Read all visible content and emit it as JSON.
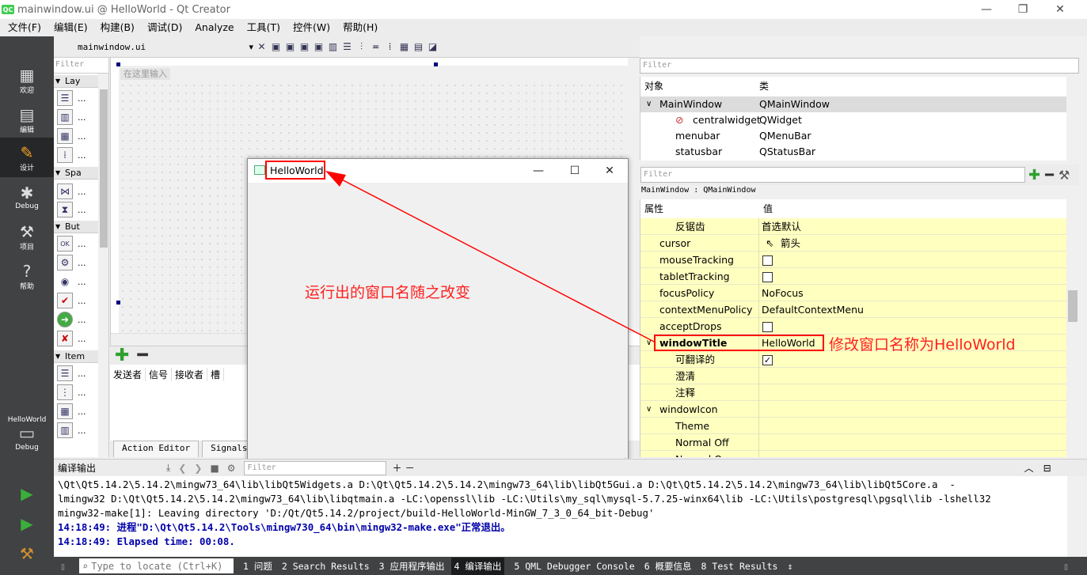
{
  "window": {
    "title": "mainwindow.ui @ HelloWorld - Qt Creator",
    "logo": "QC",
    "min": "—",
    "max": "❐",
    "close": "✕"
  },
  "menu": [
    "文件(F)",
    "编辑(E)",
    "构建(B)",
    "调试(D)",
    "Analyze",
    "工具(T)",
    "控件(W)",
    "帮助(H)"
  ],
  "modes": [
    {
      "label": "欢迎",
      "icon": "grid-icon"
    },
    {
      "label": "编辑",
      "icon": "document-icon"
    },
    {
      "label": "设计",
      "icon": "pencil-icon"
    },
    {
      "label": "Debug",
      "icon": "bug-icon"
    },
    {
      "label": "项目",
      "icon": "wrench-icon"
    },
    {
      "label": "帮助",
      "icon": "help-icon"
    }
  ],
  "project": {
    "name": "HelloWorld",
    "config": "Debug"
  },
  "widget_box": {
    "filter_placeholder": "Filter",
    "categories": [
      "Lay",
      "Spa",
      "But",
      "Item"
    ],
    "ellipsis": "..."
  },
  "design_toolbar": {
    "file": "mainwindow.ui"
  },
  "form": {
    "type_here": "在这里输入"
  },
  "signals": {
    "headers": [
      "发送者",
      "信号",
      "接收者",
      "槽"
    ],
    "tabs": [
      "Action Editor",
      "Signals _"
    ]
  },
  "object_inspector": {
    "filter_placeholder": "Filter",
    "col_object": "对象",
    "col_class": "类",
    "rows": [
      {
        "name": "MainWindow",
        "cls": "QMainWindow"
      },
      {
        "name": "centralwidget",
        "cls": "QWidget"
      },
      {
        "name": "menubar",
        "cls": "QMenuBar"
      },
      {
        "name": "statusbar",
        "cls": "QStatusBar"
      }
    ]
  },
  "property_editor": {
    "filter_placeholder": "Filter",
    "class_line": "MainWindow : QMainWindow",
    "col_prop": "属性",
    "col_value": "值",
    "rows": [
      {
        "name": "反锯齿",
        "value": "首选默认",
        "indent": 2
      },
      {
        "name": "cursor",
        "value": "箭头",
        "indent": 1,
        "icon": "arrow-cursor-icon"
      },
      {
        "name": "mouseTracking",
        "value": "",
        "indent": 1,
        "checkbox": false
      },
      {
        "name": "tabletTracking",
        "value": "",
        "indent": 1,
        "checkbox": false
      },
      {
        "name": "focusPolicy",
        "value": "NoFocus",
        "indent": 1
      },
      {
        "name": "contextMenuPolicy",
        "value": "DefaultContextMenu",
        "indent": 1
      },
      {
        "name": "acceptDrops",
        "value": "",
        "indent": 1,
        "checkbox": false
      },
      {
        "name": "windowTitle",
        "value": "HelloWorld",
        "indent": 1,
        "bold": true,
        "expand": "∨"
      },
      {
        "name": "可翻译的",
        "value": "",
        "indent": 2,
        "checkbox": true
      },
      {
        "name": "澄清",
        "value": "",
        "indent": 2
      },
      {
        "name": "注释",
        "value": "",
        "indent": 2
      },
      {
        "name": "windowIcon",
        "value": "",
        "indent": 1,
        "expand": "∨"
      },
      {
        "name": "Theme",
        "value": "",
        "indent": 2
      },
      {
        "name": "Normal Off",
        "value": "",
        "indent": 2
      },
      {
        "name": "Normal On",
        "value": "",
        "indent": 2
      }
    ]
  },
  "running_window": {
    "title": "HelloWorld"
  },
  "annotations": {
    "left": "运行出的窗口名随之改变",
    "right": "修改窗口名称为HelloWorld",
    "color": "#ff0000"
  },
  "output": {
    "title": "编译输出",
    "filter_placeholder": "Filter",
    "lines": [
      "\\Qt\\Qt5.14.2\\5.14.2\\mingw73_64\\lib\\libQt5Widgets.a D:\\Qt\\Qt5.14.2\\5.14.2\\mingw73_64\\lib\\libQt5Gui.a D:\\Qt\\Qt5.14.2\\5.14.2\\mingw73_64\\lib\\libQt5Core.a  -",
      "lmingw32 D:\\Qt\\Qt5.14.2\\5.14.2\\mingw73_64\\lib\\libqtmain.a -LC:\\openssl\\lib -LC:\\Utils\\my_sql\\mysql-5.7.25-winx64\\lib -LC:\\Utils\\postgresql\\pgsql\\lib -lshell32",
      "mingw32-make[1]: Leaving directory 'D:/Qt/Qt5.14.2/project/build-HelloWorld-MinGW_7_3_0_64_bit-Debug'",
      "14:18:49: 进程\"D:\\Qt\\Qt5.14.2\\Tools\\mingw730_64\\bin\\mingw32-make.exe\"正常退出。",
      "14:18:49: Elapsed time: 00:08."
    ]
  },
  "bottom": {
    "locator_placeholder": "Type to locate (Ctrl+K)",
    "tabs": [
      "1 问题",
      "2 Search Results",
      "3 应用程序输出",
      "4 编译输出",
      "5 QML Debugger Console",
      "6 概要信息",
      "8 Test Results"
    ]
  }
}
